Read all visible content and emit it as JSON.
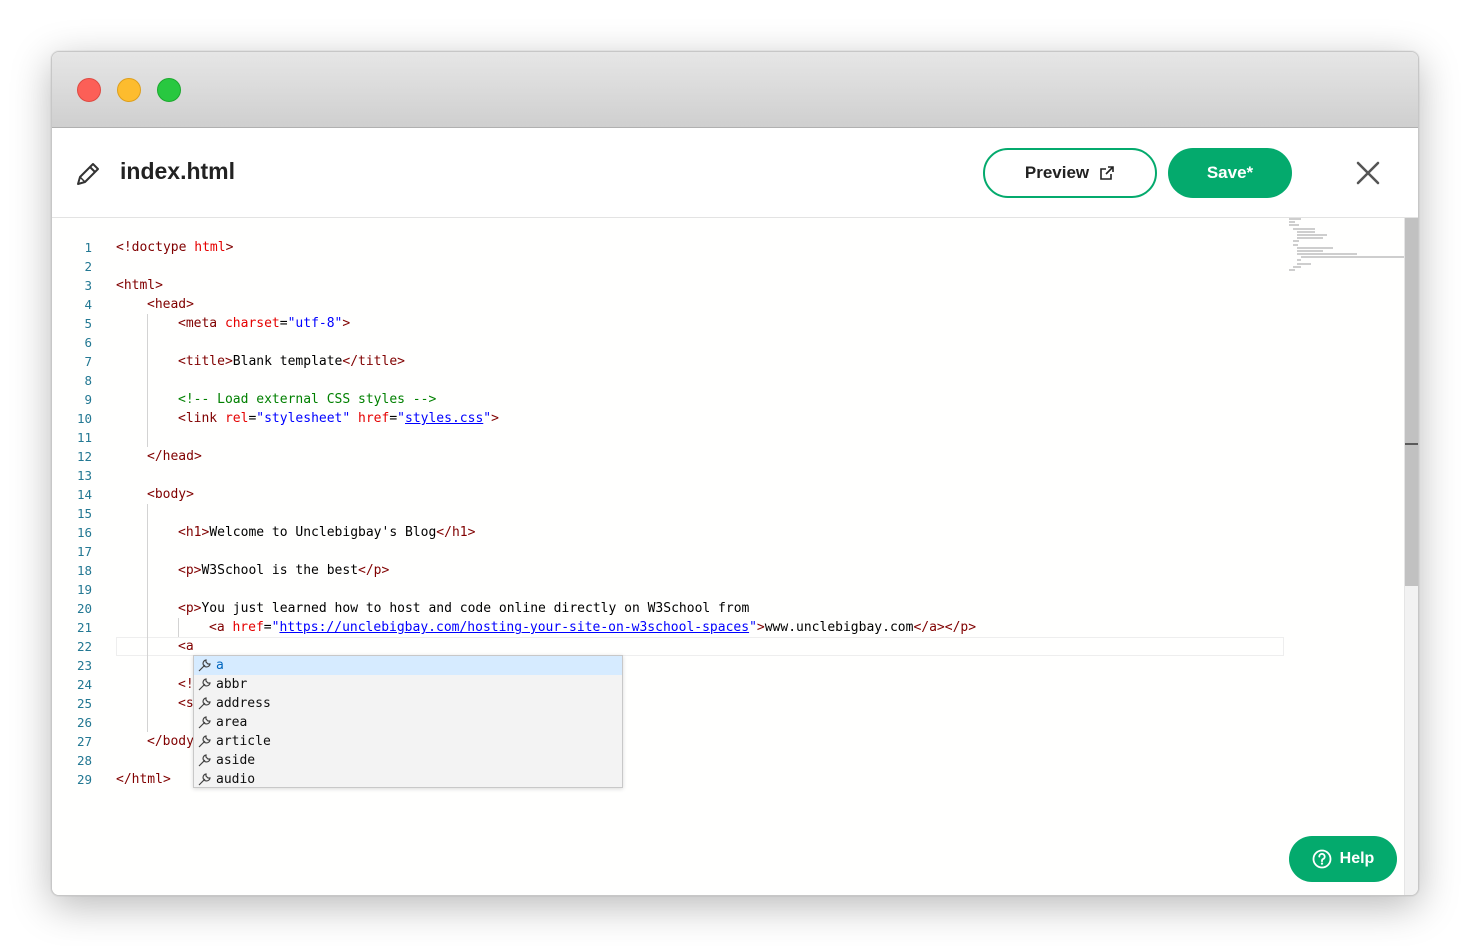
{
  "window": {
    "traffic_lights": [
      "close",
      "minimize",
      "zoom"
    ]
  },
  "header": {
    "filename": "index.html",
    "preview_label": "Preview",
    "save_label": "Save*",
    "accent_color": "#04aa6d"
  },
  "editor": {
    "line_numbers": [
      "1",
      "2",
      "3",
      "4",
      "5",
      "6",
      "7",
      "8",
      "9",
      "10",
      "11",
      "12",
      "13",
      "14",
      "15",
      "16",
      "17",
      "18",
      "19",
      "20",
      "21",
      "22",
      "23",
      "24",
      "25",
      "26",
      "27",
      "28",
      "29"
    ],
    "lines": {
      "l1": {
        "a": "<!doctype ",
        "b": "html",
        "c": ">"
      },
      "l3": {
        "a": "<html>"
      },
      "l4": {
        "a": "<head>"
      },
      "l5": {
        "a": "<meta ",
        "b": "charset",
        "c": "=",
        "d": "\"utf-8\"",
        "e": ">"
      },
      "l7": {
        "a": "<title>",
        "b": "Blank template",
        "c": "</title>"
      },
      "l9": {
        "a": "<!-- Load external CSS styles -->"
      },
      "l10": {
        "a": "<link ",
        "b": "rel",
        "c": "=",
        "d": "\"stylesheet\"",
        "e": " href",
        "f": "=",
        "g": "\"",
        "h": "styles.css",
        "i": "\"",
        "j": ">"
      },
      "l12": {
        "a": "</head>"
      },
      "l14": {
        "a": "<body>"
      },
      "l16": {
        "a": "<h1>",
        "b": "Welcome to Unclebigbay's Blog",
        "c": "</h1>"
      },
      "l18": {
        "a": "<p>",
        "b": "W3School is the best",
        "c": "</p>"
      },
      "l20": {
        "a": "<p>",
        "b": "You just learned how to host and code online directly on W3School from"
      },
      "l21": {
        "a": "<a ",
        "b": "href",
        "c": "=",
        "d": "\"",
        "e": "https://unclebigbay.com/hosting-your-site-on-w3school-spaces",
        "f": "\"",
        "g": ">",
        "h": "www.unclebigbay.com",
        "i": "</a></p>"
      },
      "l22": {
        "a": "<a"
      },
      "l24": {
        "a": "<!"
      },
      "l25": {
        "a": "<s"
      },
      "l27": {
        "a": "</body"
      },
      "l29": {
        "a": "</html>"
      }
    }
  },
  "suggestions": {
    "items": [
      "a",
      "abbr",
      "address",
      "area",
      "article",
      "aside",
      "audio"
    ],
    "selected_index": 0
  },
  "help": {
    "label": "Help"
  }
}
